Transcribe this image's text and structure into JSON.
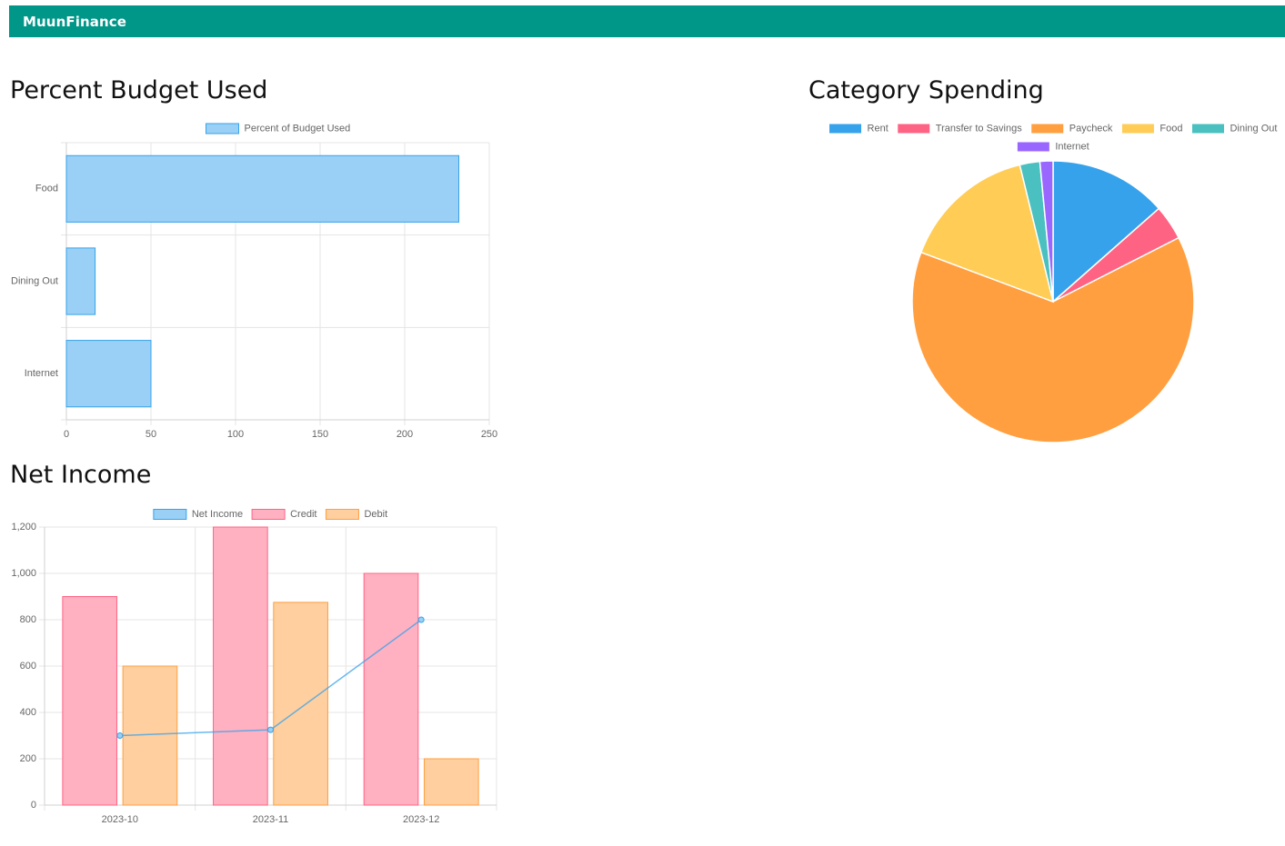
{
  "navbar": {
    "brand": "MuunFinance"
  },
  "sections": {
    "budget_title": "Percent Budget Used",
    "category_title": "Category Spending",
    "net_title": "Net Income"
  },
  "chart_data": [
    {
      "id": "budget",
      "type": "bar",
      "orientation": "horizontal",
      "categories": [
        "Food",
        "Dining Out",
        "Internet"
      ],
      "series": [
        {
          "name": "Percent of Budget Used",
          "values": [
            232,
            17,
            50
          ],
          "color": "#9ad0f5",
          "border": "#36a2eb"
        }
      ],
      "xlim": [
        0,
        250
      ],
      "xticks": [
        0,
        50,
        100,
        150,
        200,
        250
      ],
      "grid": true,
      "legend": "top"
    },
    {
      "id": "category",
      "type": "pie",
      "labels": [
        "Rent",
        "Transfer to Savings",
        "Paycheck",
        "Food",
        "Dining Out",
        "Internet"
      ],
      "values": [
        13.5,
        4,
        63.2,
        15.5,
        2.3,
        1.5
      ],
      "colors": [
        "#36a2eb",
        "#ff6384",
        "#ff9f40",
        "#ffcd56",
        "#4bc0c0",
        "#9966ff"
      ],
      "legend": "top"
    },
    {
      "id": "net",
      "type": "bar",
      "categories": [
        "2023-10",
        "2023-11",
        "2023-12"
      ],
      "series": [
        {
          "name": "Net Income",
          "kind": "line",
          "values": [
            300,
            325,
            800
          ],
          "color": "#9ad0f5",
          "border": "#36a2eb"
        },
        {
          "name": "Credit",
          "kind": "bar",
          "values": [
            900,
            1200,
            1000
          ],
          "color": "#ffb1c1",
          "border": "#ff6384"
        },
        {
          "name": "Debit",
          "kind": "bar",
          "values": [
            600,
            875,
            200
          ],
          "color": "#ffcf9f",
          "border": "#ff9f40"
        }
      ],
      "ylim": [
        0,
        1200
      ],
      "yticks": [
        "0",
        "200",
        "400",
        "600",
        "800",
        "1,000",
        "1,200"
      ],
      "grid": true,
      "legend": "top"
    }
  ]
}
